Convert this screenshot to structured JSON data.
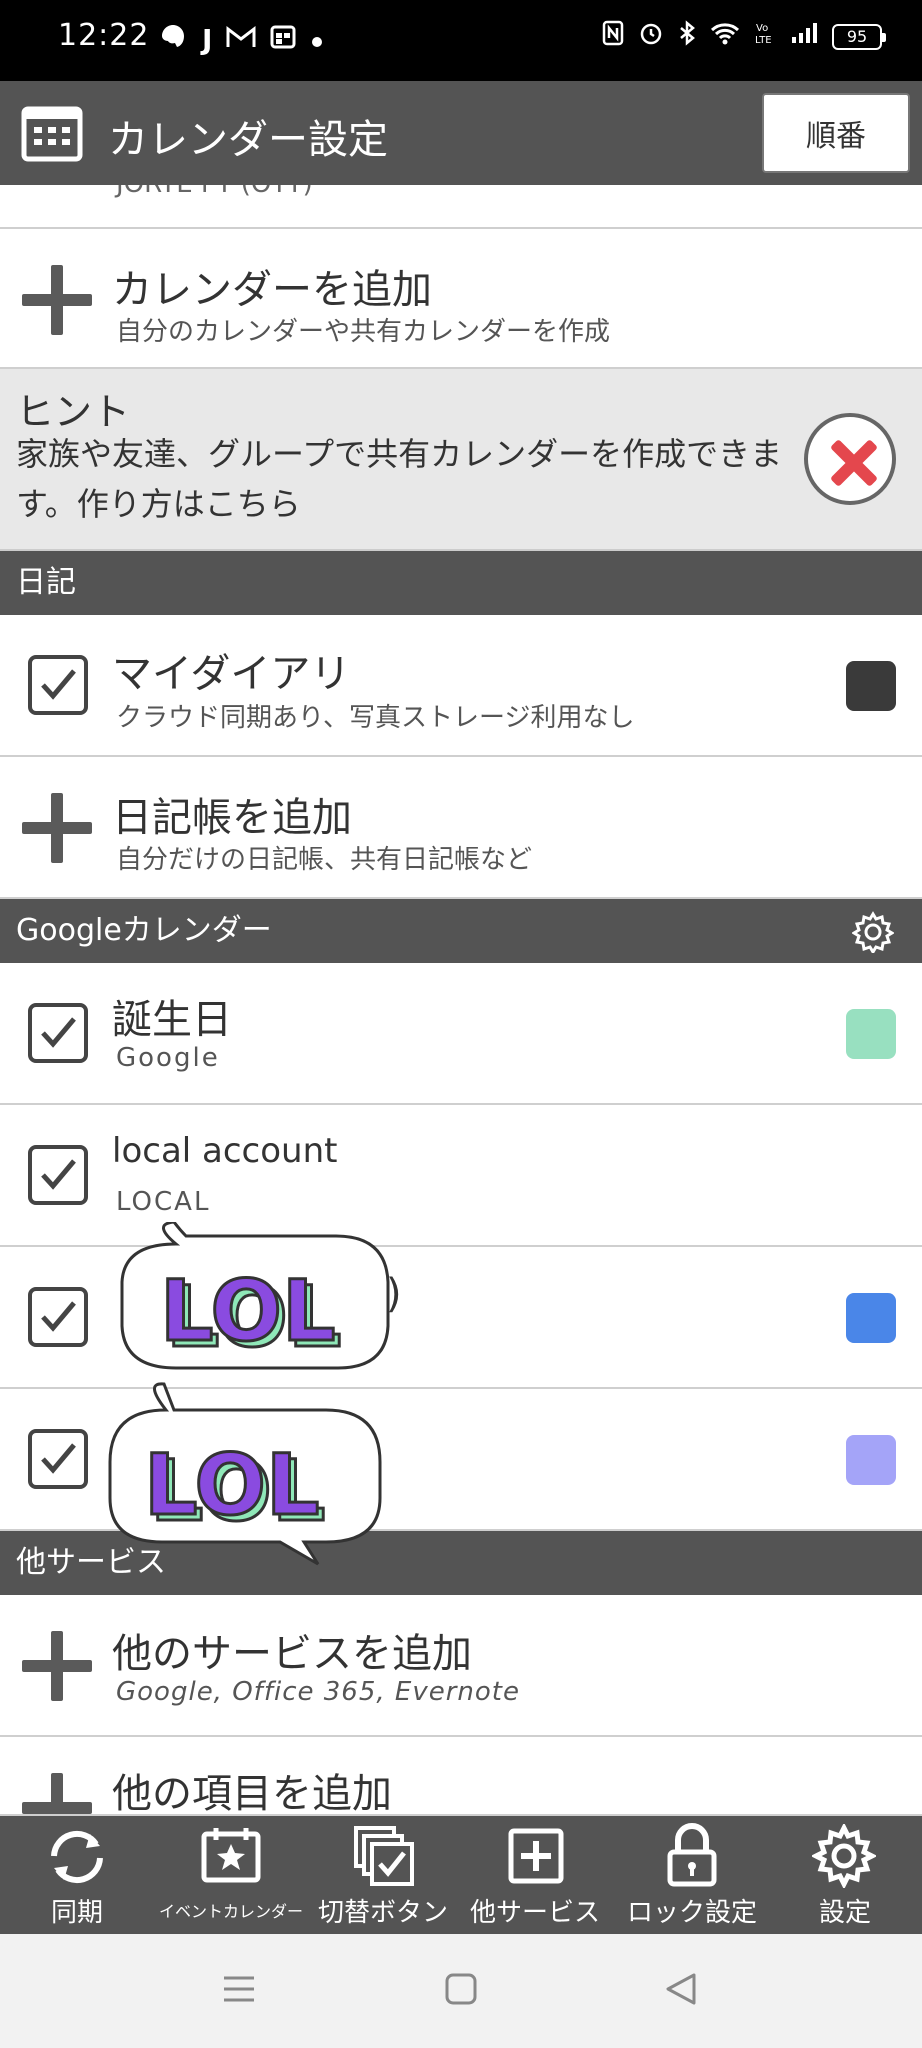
{
  "status": {
    "time": "12:22",
    "battery": "95",
    "left_icons": [
      "notification-icon",
      "j-icon",
      "gmail-icon",
      "calendar-app-icon",
      "dot-icon"
    ],
    "right_icons": [
      "nfc-icon",
      "alarm-icon",
      "bluetooth-icon",
      "wifi-icon",
      "volte-icon",
      "signal-icon",
      "battery-icon"
    ]
  },
  "appbar": {
    "title": "カレンダー設定",
    "order_button": "順番"
  },
  "partial_row": {
    "text": "JORTE PT (OTT)"
  },
  "add_calendar": {
    "title": "カレンダーを追加",
    "subtitle": "自分のカレンダーや共有カレンダーを作成"
  },
  "hint": {
    "title": "ヒント",
    "body": "家族や友達、グループで共有カレンダーを作成できます。作り方はこちら"
  },
  "diary_section": {
    "title": "日記"
  },
  "my_diary": {
    "title": "マイダイアリ",
    "subtitle": "クラウド同期あり、写真ストレージ利用なし",
    "color": "#3a3a3a"
  },
  "add_diary": {
    "title": "日記帳を追加",
    "subtitle": "自分だけの日記帳、共有日記帳など"
  },
  "google_section": {
    "title": "Googleカレンダー"
  },
  "birthday": {
    "title": "誕生日",
    "subtitle": "Google",
    "color": "#98e0c0"
  },
  "local_account": {
    "title": "local account",
    "subtitle": "LOCAL"
  },
  "hidden_row1": {
    "title_tail": ")",
    "color": "#4a86e8"
  },
  "hidden_row2": {
    "color": "#a4a4f8"
  },
  "stickers": {
    "text": "LOL"
  },
  "other_section": {
    "title": "他サービス"
  },
  "add_service": {
    "title": "他のサービスを追加",
    "subtitle": "Google, Office 365, Evernote"
  },
  "add_item": {
    "title": "他の項目を追加"
  },
  "bottom_nav": [
    {
      "label": "同期",
      "icon": "sync-icon"
    },
    {
      "label": "イベントカレンダー",
      "icon": "event-calendar-icon"
    },
    {
      "label": "切替ボタン",
      "icon": "switch-icon"
    },
    {
      "label": "他サービス",
      "icon": "add-service-icon"
    },
    {
      "label": "ロック設定",
      "icon": "lock-icon"
    },
    {
      "label": "設定",
      "icon": "gear-icon"
    }
  ],
  "colors": {
    "bar": "#545454",
    "hint_bg": "#e8e8e8",
    "close": "#e4474d",
    "lol_fill": "#8a4be0",
    "lol_side": "#8fe8b8"
  }
}
